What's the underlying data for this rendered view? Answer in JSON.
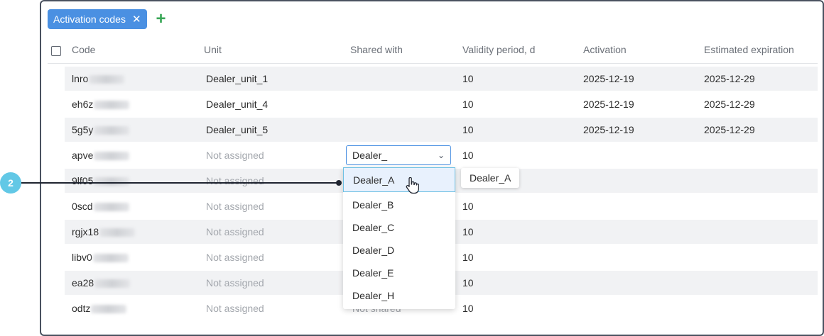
{
  "filter": {
    "tag_label": "Activation codes",
    "close": "✕",
    "add": "+"
  },
  "headers": [
    "Code",
    "Unit",
    "Shared with",
    "Validity period, d",
    "Activation",
    "Estimated expiration"
  ],
  "rows": [
    {
      "code": "lnro",
      "unit": "Dealer_unit_1",
      "unit_assigned": true,
      "shared": "",
      "validity": "10",
      "activation": "2025-12-19",
      "expiration": "2025-12-29"
    },
    {
      "code": "eh6z",
      "unit": "Dealer_unit_4",
      "unit_assigned": true,
      "shared": "",
      "validity": "10",
      "activation": "2025-12-19",
      "expiration": "2025-12-29"
    },
    {
      "code": "5g5y",
      "unit": "Dealer_unit_5",
      "unit_assigned": true,
      "shared": "",
      "validity": "10",
      "activation": "2025-12-19",
      "expiration": "2025-12-29"
    },
    {
      "code": "apve",
      "unit": "Not assigned",
      "unit_assigned": false,
      "shared": "",
      "validity": "10",
      "activation": "",
      "expiration": ""
    },
    {
      "code": "9lf05",
      "unit": "Not assigned",
      "unit_assigned": false,
      "shared": "",
      "validity": "",
      "activation": "",
      "expiration": ""
    },
    {
      "code": "0scd",
      "unit": "Not assigned",
      "unit_assigned": false,
      "shared": "",
      "validity": "10",
      "activation": "",
      "expiration": ""
    },
    {
      "code": "rgjx18",
      "unit": "Not assigned",
      "unit_assigned": false,
      "shared": "",
      "validity": "10",
      "activation": "",
      "expiration": ""
    },
    {
      "code": "libv0",
      "unit": "Not assigned",
      "unit_assigned": false,
      "shared": "",
      "validity": "10",
      "activation": "",
      "expiration": ""
    },
    {
      "code": "ea28",
      "unit": "Not assigned",
      "unit_assigned": false,
      "shared": "",
      "validity": "10",
      "activation": "",
      "expiration": ""
    },
    {
      "code": "odtz",
      "unit": "Not assigned",
      "unit_assigned": false,
      "shared": "Not shared",
      "validity": "10",
      "activation": "",
      "expiration": ""
    }
  ],
  "shared_select": {
    "value": "Dealer_",
    "chevron": "⌄"
  },
  "dropdown_options": [
    "Dealer_A",
    "Dealer_B",
    "Dealer_C",
    "Dealer_D",
    "Dealer_E",
    "Dealer_H"
  ],
  "tooltip": "Dealer_A",
  "callout": {
    "number": "2"
  },
  "colors": {
    "accent": "#4a90e2",
    "add": "#3aa757",
    "badge": "#62c8e6"
  }
}
